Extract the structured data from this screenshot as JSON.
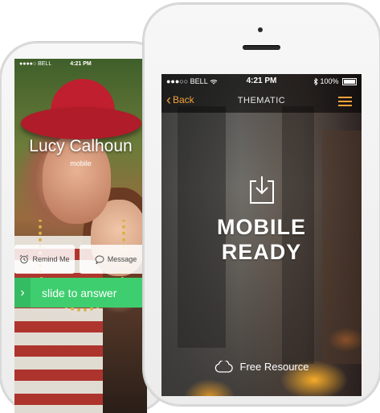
{
  "back_phone": {
    "status": {
      "carrier": "●●●●○ BELL",
      "time": "4:21 PM"
    },
    "caller": {
      "name": "Lucy Calhoun",
      "label": "mobile"
    },
    "actions": [
      {
        "label": "Remind Me",
        "icon": "alarm-clock-icon"
      },
      {
        "label": "Message",
        "icon": "speech-bubble-icon"
      }
    ],
    "slider": {
      "label": "slide to answer",
      "icon": "chevron-right-icon"
    }
  },
  "front_phone": {
    "status": {
      "carrier": "●●●○○ BELL",
      "time": "4:21 PM",
      "battery": "100%",
      "icons": [
        "wifi-icon",
        "bluetooth-icon",
        "battery-icon"
      ]
    },
    "nav": {
      "back_label": "Back",
      "title": "THEMATIC",
      "menu_icon": "hamburger-menu-icon"
    },
    "hero": {
      "line1": "MOBILE",
      "line2": "READY",
      "icon": "download-icon"
    },
    "footer": {
      "label": "Free Resource",
      "icon": "cloud-icon"
    }
  },
  "colors": {
    "accent_orange": "#f2a23a",
    "answer_green": "#3fce6f",
    "device_silver": "#efefef"
  }
}
